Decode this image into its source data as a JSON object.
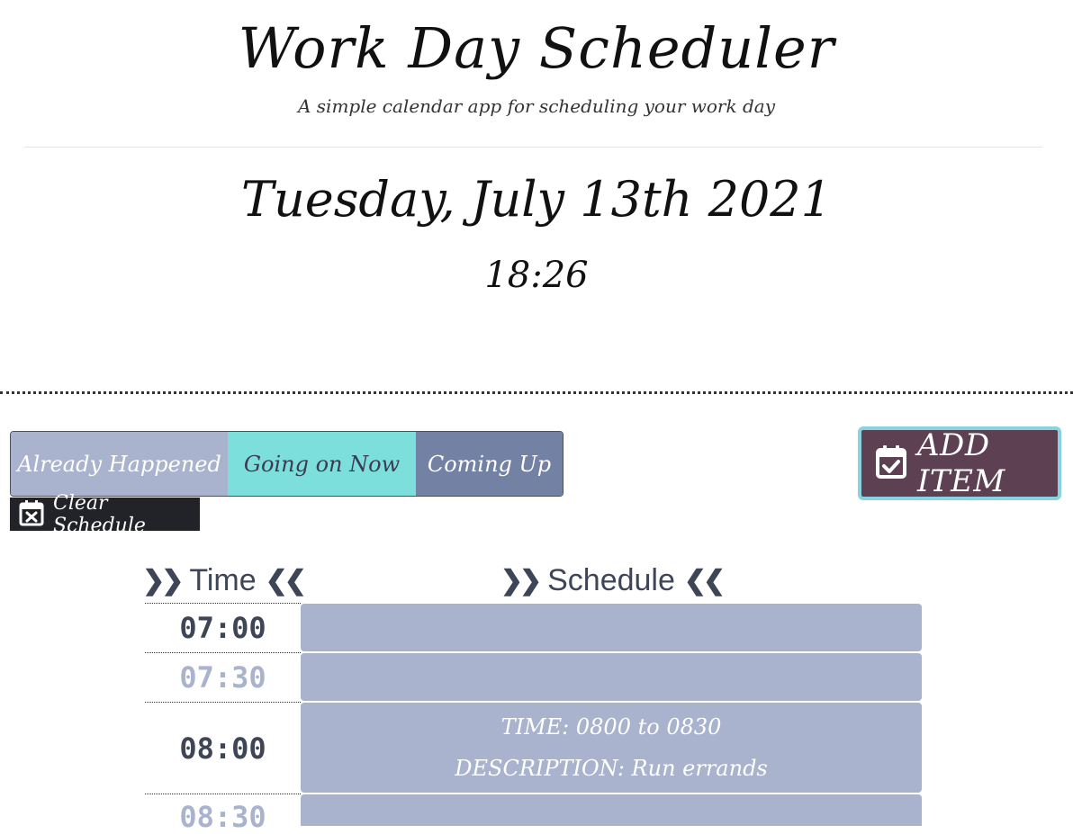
{
  "header": {
    "title": "Work Day Scheduler",
    "subtitle": "A simple calendar app for scheduling your work day"
  },
  "clock": {
    "date": "Tuesday, July 13th 2021",
    "time": "18:26"
  },
  "legend": {
    "past": "Already Happened",
    "present": "Going on Now",
    "future": "Coming Up"
  },
  "buttons": {
    "add_item": "ADD ITEM",
    "clear_schedule": "Clear Schedule"
  },
  "table": {
    "time_header": "Time",
    "schedule_header": "Schedule",
    "rows": [
      {
        "time": "07:00",
        "entry_time": "",
        "entry_description": ""
      },
      {
        "time": "07:30",
        "entry_time": "",
        "entry_description": ""
      },
      {
        "time": "08:00",
        "entry_time": "TIME: 0800 to 0830",
        "entry_description": "DESCRIPTION: Run errands"
      },
      {
        "time": "08:30",
        "entry_time": "",
        "entry_description": ""
      }
    ]
  },
  "colors": {
    "past": "#a9b3ce",
    "present": "#7ddfdc",
    "future": "#7381a4",
    "add_button": "#5d4153",
    "clear_button": "#222328"
  },
  "icons": {
    "add_item": "calendar-check-icon",
    "clear_schedule": "calendar-x-icon",
    "header_decoration": "double-chevron-icon"
  }
}
